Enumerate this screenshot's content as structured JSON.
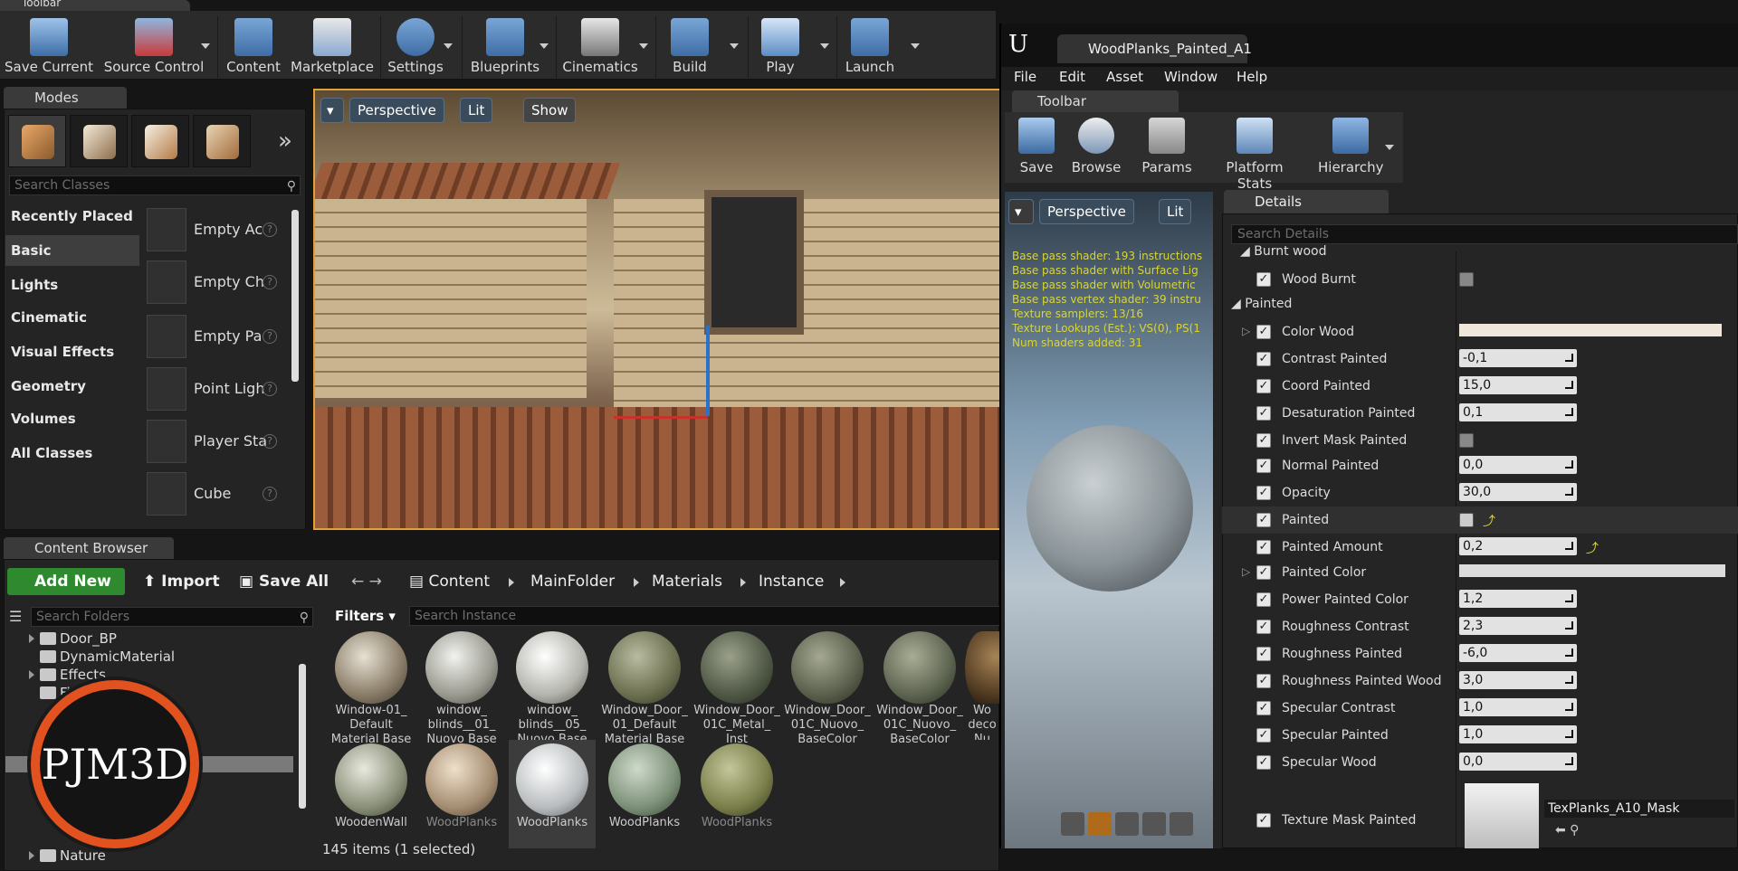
{
  "toolbar_tab": {
    "label": "Toolbar"
  },
  "main_toolbar": {
    "buttons": [
      {
        "label": "Save Current"
      },
      {
        "label": "Source Control"
      },
      {
        "label": "Content"
      },
      {
        "label": "Marketplace"
      },
      {
        "label": "Settings"
      },
      {
        "label": "Blueprints"
      },
      {
        "label": "Cinematics"
      },
      {
        "label": "Build"
      },
      {
        "label": "Play"
      },
      {
        "label": "Launch"
      }
    ]
  },
  "modes": {
    "tab_label": "Modes",
    "search_placeholder": "Search Classes",
    "categories": [
      "Recently Placed",
      "Basic",
      "Lights",
      "Cinematic",
      "Visual Effects",
      "Geometry",
      "Volumes",
      "All Classes"
    ],
    "items": [
      {
        "name": "Empty Ac",
        "help": "?"
      },
      {
        "name": "Empty Ch",
        "help": "?"
      },
      {
        "name": "Empty Pa",
        "help": "?"
      },
      {
        "name": "Point Ligh",
        "help": "?"
      },
      {
        "name": "Player Sta",
        "help": "?"
      },
      {
        "name": "Cube",
        "help": "?"
      }
    ]
  },
  "viewport": {
    "perspective": "Perspective",
    "lit": "Lit",
    "show": "Show"
  },
  "content_browser": {
    "tab_label": "Content Browser",
    "add_new": "Add New",
    "import": "Import",
    "save_all": "Save All",
    "breadcrumb": [
      "Content",
      "MainFolder",
      "Materials",
      "Instance"
    ],
    "search_folders_placeholder": "Search Folders",
    "folders": [
      "Door_BP",
      "DynamicMaterial",
      "Effects",
      "Fi",
      "Nature"
    ],
    "filters_label": "Filters",
    "search_instance_placeholder": "Search Instance",
    "assets_row1": [
      "Window-01_ Default Material Base",
      "window_ blinds__01_ Nuovo Base",
      "window_ blinds__05_ Nuovo Base",
      "Window_Door_ 01_Default Material Base",
      "Window_Door_ 01C_Metal_ Inst",
      "Window_Door_ 01C_Nuovo_ BaseColor",
      "Window_Door_ 01C_Nuovo_ BaseColor",
      "Wo deco Nu"
    ],
    "assets_row2": [
      "WoodenWall",
      "WoodPlanks",
      "WoodPlanks",
      "WoodPlanks",
      "WoodPlanks"
    ],
    "item_count": "145 items (1 selected)"
  },
  "logo": {
    "text": "PJM3D"
  },
  "material_editor": {
    "tab_title": "WoodPlanks_Painted_A1",
    "menu": [
      "File",
      "Edit",
      "Asset",
      "Window",
      "Help"
    ],
    "toolbar_tab": "Toolbar",
    "toolbar_buttons": [
      "Save",
      "Browse",
      "Params",
      "Platform Stats",
      "Hierarchy"
    ],
    "preview": {
      "perspective": "Perspective",
      "lit": "Lit",
      "stats": [
        "Base pass shader: 193 instructions",
        "Base pass shader with Surface Lig",
        "Base pass shader with Volumetric",
        "Base pass vertex shader: 39 instru",
        "Texture samplers: 13/16",
        "Texture Lookups (Est.): VS(0), PS(1",
        "Num shaders added: 31"
      ]
    },
    "details": {
      "tab_label": "Details",
      "search_placeholder": "Search Details",
      "group_burnt": "Burnt wood",
      "group_painted": "Painted",
      "properties": [
        {
          "name": "Wood Burnt",
          "value": ""
        },
        {
          "name": "Color Wood",
          "value": ""
        },
        {
          "name": "Contrast Painted",
          "value": "-0,1"
        },
        {
          "name": "Coord Painted",
          "value": "15,0"
        },
        {
          "name": "Desaturation Painted",
          "value": "0,1"
        },
        {
          "name": "Invert Mask Painted",
          "value": ""
        },
        {
          "name": "Normal Painted",
          "value": "0,0"
        },
        {
          "name": "Opacity",
          "value": "30,0"
        },
        {
          "name": "Painted",
          "value": ""
        },
        {
          "name": "Painted Amount",
          "value": "0,2"
        },
        {
          "name": "Painted Color",
          "value": ""
        },
        {
          "name": "Power Painted Color",
          "value": "1,2"
        },
        {
          "name": "Roughness Contrast",
          "value": "2,3"
        },
        {
          "name": "Roughness Painted",
          "value": "-6,0"
        },
        {
          "name": "Roughness Painted Wood",
          "value": "3,0"
        },
        {
          "name": "Specular Contrast",
          "value": "1,0"
        },
        {
          "name": "Specular Painted",
          "value": "1,0"
        },
        {
          "name": "Specular Wood",
          "value": "0,0"
        },
        {
          "name": "Texture Mask Painted",
          "value": "TexPlanks_A10_Mask"
        }
      ]
    }
  },
  "colors": {
    "accent_green": "#2f8a2f",
    "selection_orange": "#e0a03a",
    "stats_yellow": "#d7d43a"
  }
}
